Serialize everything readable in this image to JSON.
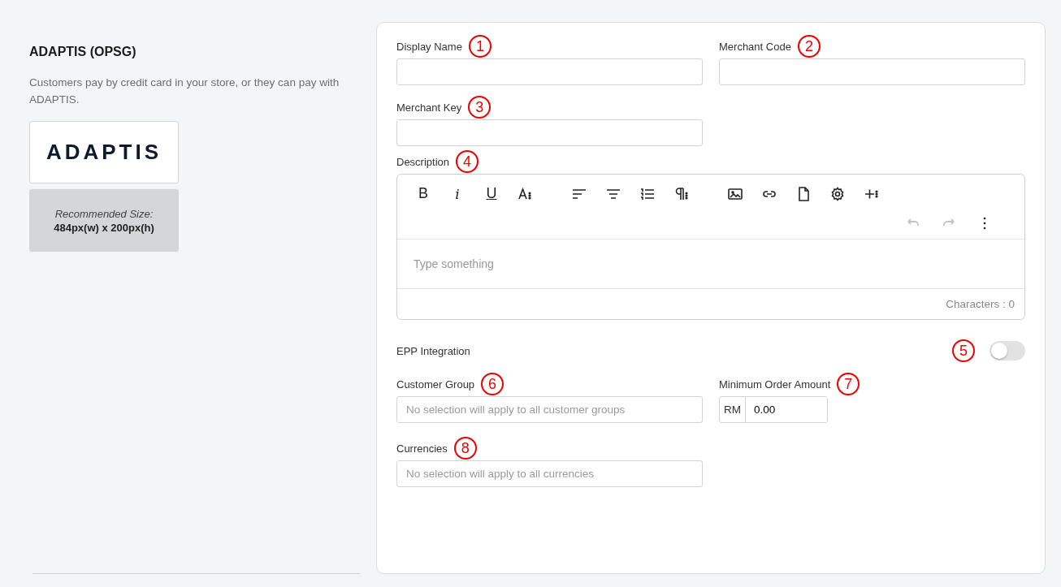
{
  "gateway": {
    "title": "ADAPTIS (OPSG)",
    "description": "Customers pay by credit card in your store, or they can pay with ADAPTIS.",
    "logo_text": "ADAPTIS",
    "recommended_label": "Recommended Size:",
    "recommended_size": "484px(w) x 200px(h)"
  },
  "fields": [
    {
      "label": "Display Name",
      "callout": "1"
    },
    {
      "label": "Merchant Code",
      "callout": "2"
    },
    {
      "label": "Merchant Key",
      "callout": "3"
    }
  ],
  "description": {
    "label": "Description",
    "callout": "4",
    "toolbar": [
      {
        "kind": "text",
        "label": "B"
      },
      {
        "kind": "text",
        "label": "i"
      },
      {
        "kind": "text",
        "label": "U"
      },
      {
        "kind": "icon"
      },
      {
        "kind": "icon"
      },
      {
        "kind": "icon"
      },
      {
        "kind": "icon"
      },
      {
        "kind": "icon"
      },
      {
        "kind": "icon"
      },
      {
        "kind": "icon"
      },
      {
        "kind": "icon"
      },
      {
        "kind": "icon"
      },
      {
        "kind": "icon"
      }
    ],
    "history": [
      {
        "disabled": true
      },
      {
        "disabled": true
      },
      {
        "disabled": false
      }
    ],
    "placeholder": "Type something",
    "counter": "Characters : 0"
  },
  "epp": {
    "label": "EPP Integration",
    "callout": "5",
    "on": false
  },
  "customer_group": {
    "label": "Customer Group",
    "callout": "6",
    "placeholder": "No selection will apply to all customer groups"
  },
  "minimum_order": {
    "label": "Minimum Order Amount",
    "callout": "7",
    "prefix": "RM",
    "value": "0.00"
  },
  "currencies": {
    "label": "Currencies",
    "callout": "8",
    "placeholder": "No selection will apply to all currencies"
  }
}
